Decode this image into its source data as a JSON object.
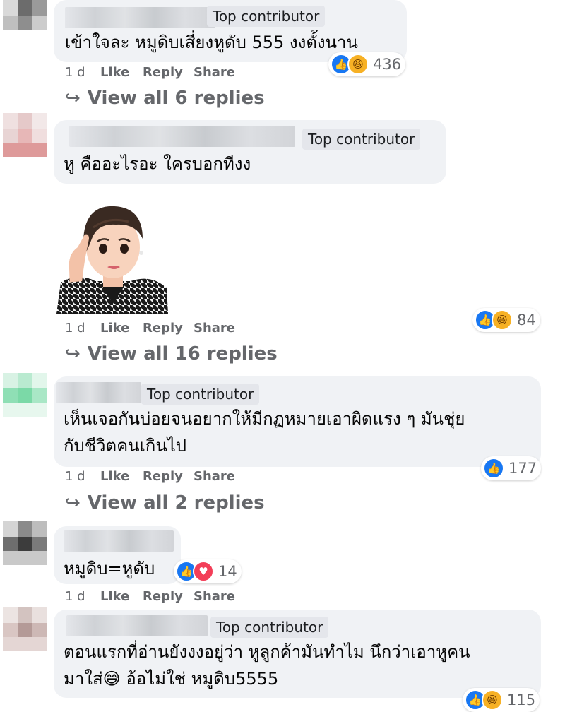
{
  "badge_label": "Top contributor",
  "comments": [
    {
      "text_lines": [
        "เข้าใจละ หมูดิบเสี่ยงหูดับ 555 งงตั้งนาน"
      ],
      "time": "1 d",
      "like": "Like",
      "reply": "Reply",
      "share": "Share",
      "reactions": [
        "like-icon",
        "haha-icon"
      ],
      "reaction_count": "436",
      "view_replies": "View all 6 replies"
    },
    {
      "text_lines": [
        "หู คืออะไรอะ ใครบอกทีงง"
      ],
      "has_sticker": true,
      "time": "1 d",
      "like": "Like",
      "reply": "Reply",
      "share": "Share",
      "reactions": [
        "like-icon",
        "haha-icon"
      ],
      "reaction_count": "84",
      "view_replies": "View all 16 replies"
    },
    {
      "text_lines": [
        "เห็นเจอกันบ่อยจนอยากให้มีกฏหมายเอาผิดแรง ๆ มันชุ่ย",
        "กับชีวิตคนเกินไป"
      ],
      "time": "1 d",
      "like": "Like",
      "reply": "Reply",
      "share": "Share",
      "reactions": [
        "like-icon"
      ],
      "reaction_count": "177",
      "view_replies": "View all 2 replies"
    },
    {
      "text_lines": [
        "หมูดิบ=หูดับ"
      ],
      "time": "1 d",
      "like": "Like",
      "reply": "Reply",
      "share": "Share",
      "reactions": [
        "like-icon",
        "love-icon"
      ],
      "reaction_count": "14"
    },
    {
      "text_lines": [
        "ตอนแรกที่อ่านยังงงอยู่ว่า หูลูกค้ามันทำไม นึกว่าเอาหูคน",
        "มาใส่😅 อ้อไม่ใช่ หมูดิบ5555"
      ],
      "reactions": [
        "like-icon",
        "haha-icon"
      ],
      "reaction_count": "115"
    }
  ],
  "colors": {
    "bubble": "#f0f2f5",
    "meta": "#65676b",
    "like": "#1877f2",
    "haha": "#f7b125",
    "love": "#f33e58"
  }
}
